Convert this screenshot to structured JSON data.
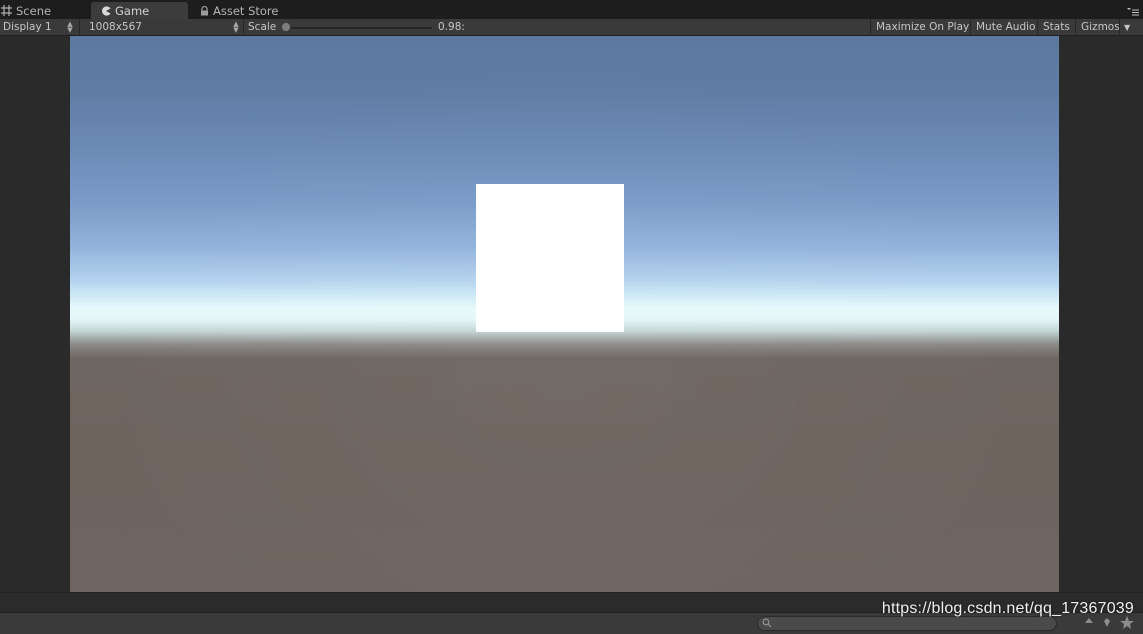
{
  "tabs": [
    {
      "label": "Scene",
      "icon": "scene-grid-icon"
    },
    {
      "label": "Game",
      "icon": "game-pacman-icon",
      "active": true
    },
    {
      "label": "Asset Store",
      "icon": "lock-icon"
    }
  ],
  "toolbar": {
    "display_label": "Display 1",
    "resolution_label": "1008x567",
    "scale_label": "Scale",
    "scale_value": "0.98:",
    "scale_fraction": 0.0,
    "maximize_label": "Maximize On Play",
    "mute_label": "Mute Audio",
    "stats_label": "Stats",
    "gizmos_label": "Gizmos"
  },
  "viewport": {
    "sky_color_top": "#5c7aa0",
    "horizon_color": "#e7fafb",
    "ground_color": "#6e6560",
    "object_color": "#ffffff"
  },
  "footer": {
    "watermark": "https://blog.csdn.net/qq_17367039",
    "search_placeholder": ""
  }
}
